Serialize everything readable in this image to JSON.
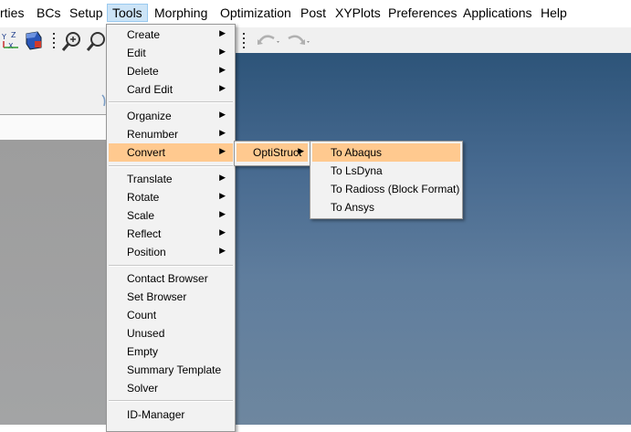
{
  "menubar": {
    "items": [
      "rties",
      "BCs",
      "Setup",
      "Tools",
      "Morphing",
      "Optimization",
      "Post",
      "XYPlots",
      "Preferences",
      "Applications",
      "Help"
    ]
  },
  "tools_menu": {
    "items": [
      {
        "label": "Create",
        "submenu": true
      },
      {
        "label": "Edit",
        "submenu": true
      },
      {
        "label": "Delete",
        "submenu": true
      },
      {
        "label": "Card Edit",
        "submenu": true
      },
      {
        "label": "Organize",
        "submenu": true
      },
      {
        "label": "Renumber",
        "submenu": true
      },
      {
        "label": "Convert",
        "submenu": true
      },
      {
        "label": "Translate",
        "submenu": true
      },
      {
        "label": "Rotate",
        "submenu": true
      },
      {
        "label": "Scale",
        "submenu": true
      },
      {
        "label": "Reflect",
        "submenu": true
      },
      {
        "label": "Position",
        "submenu": true
      },
      {
        "label": "Contact Browser",
        "submenu": false
      },
      {
        "label": "Set Browser",
        "submenu": false
      },
      {
        "label": "Count",
        "submenu": false
      },
      {
        "label": "Unused",
        "submenu": false
      },
      {
        "label": "Empty",
        "submenu": false
      },
      {
        "label": "Summary Template",
        "submenu": false
      },
      {
        "label": "Solver",
        "submenu": false
      },
      {
        "label": "ID-Manager",
        "submenu": false
      }
    ]
  },
  "convert_menu": {
    "items": [
      {
        "label": "OptiStruct",
        "submenu": true
      }
    ]
  },
  "optistruct_menu": {
    "items": [
      {
        "label": "To Abaqus"
      },
      {
        "label": "To LsDyna"
      },
      {
        "label": "To Radioss (Block Format)"
      },
      {
        "label": "To Ansys"
      }
    ]
  },
  "colors": {
    "highlight": "#ffc98f",
    "menu_bg": "#f2f2f2",
    "active_menu": "#cce4f7"
  }
}
